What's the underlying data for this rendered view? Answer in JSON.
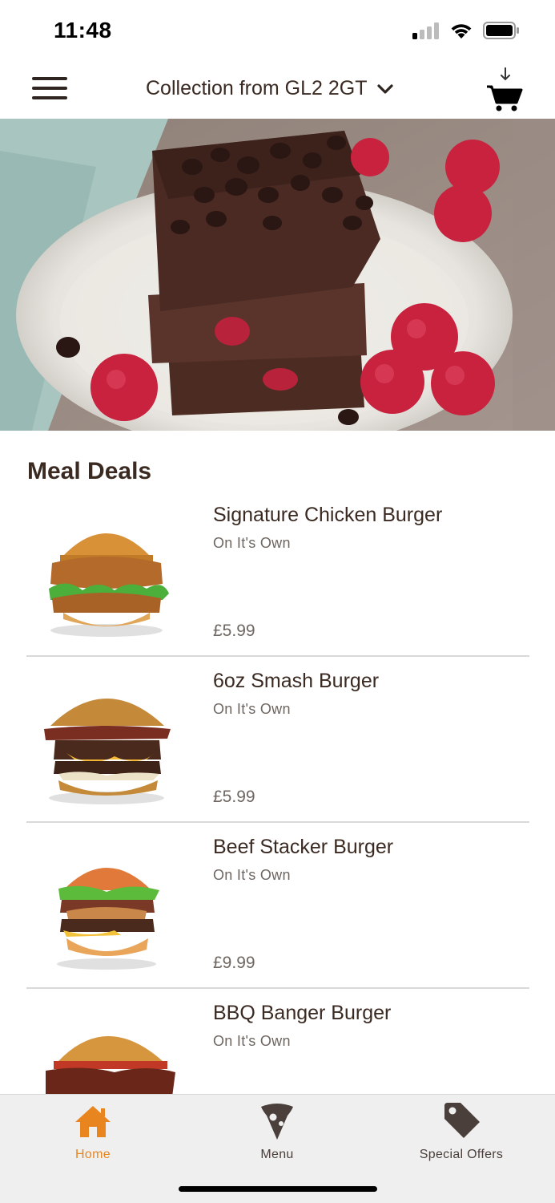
{
  "status_bar": {
    "time": "11:48"
  },
  "header": {
    "location": "Collection from GL2 2GT"
  },
  "section": {
    "title": "Meal Deals"
  },
  "items": [
    {
      "name": "Signature Chicken Burger",
      "desc": "On It's Own",
      "price": "£5.99"
    },
    {
      "name": "6oz Smash Burger",
      "desc": "On It's Own",
      "price": "£5.99"
    },
    {
      "name": "Beef Stacker Burger",
      "desc": "On It's Own",
      "price": "£9.99"
    },
    {
      "name": "BBQ Banger Burger",
      "desc": "On It's Own",
      "price": ""
    }
  ],
  "nav": {
    "home": "Home",
    "menu": "Menu",
    "offers": "Special Offers"
  },
  "colors": {
    "accent": "#e8851e",
    "text": "#3a2a22",
    "muted": "#6e6661"
  }
}
